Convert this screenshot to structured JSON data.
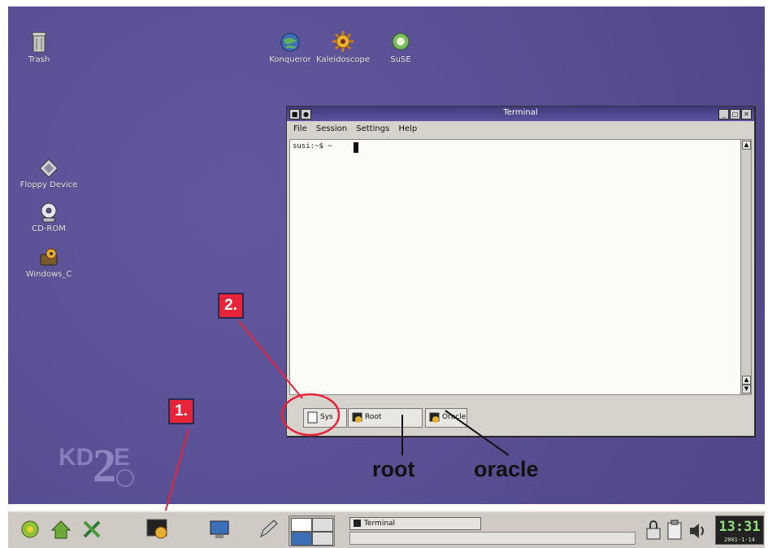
{
  "desktop": {
    "icons": [
      {
        "label": "Trash",
        "icon": "trash-icon"
      },
      {
        "label": "Konqueror",
        "icon": "globe-icon"
      },
      {
        "label": "Kaleidoscope",
        "icon": "gear-sun-icon"
      },
      {
        "label": "SuSE",
        "icon": "suse-icon"
      },
      {
        "label": "Floppy Device",
        "icon": "floppy-icon"
      },
      {
        "label": "CD-ROM",
        "icon": "cdrom-icon"
      },
      {
        "label": "Windows_C",
        "icon": "drive-icon"
      }
    ]
  },
  "terminal": {
    "title": "Terminal",
    "menu": [
      "File",
      "Session",
      "Settings",
      "Help"
    ],
    "prompt": "susi:~$ ~",
    "tabs": [
      {
        "label": "Sys",
        "icon": "page-icon"
      },
      {
        "label": "Root",
        "icon": "terminal-icon"
      },
      {
        "label": "Oracle",
        "icon": "terminal-icon"
      }
    ]
  },
  "annotations": {
    "marker_1": "1.",
    "marker_2": "2.",
    "root_label": "root",
    "oracle_label": "oracle",
    "circle_color": "#e8243a",
    "marker_color": "#e8243a"
  },
  "kde_logo": "KDE 2",
  "taskbar": {
    "task_label": "Terminal",
    "clock": "13:31",
    "date": "2001-1-14",
    "quick_icons": [
      "kde-menu-icon",
      "home-icon",
      "tools-icon",
      "new-konsole-icon",
      "monitor-icon",
      "pen-icon"
    ]
  }
}
